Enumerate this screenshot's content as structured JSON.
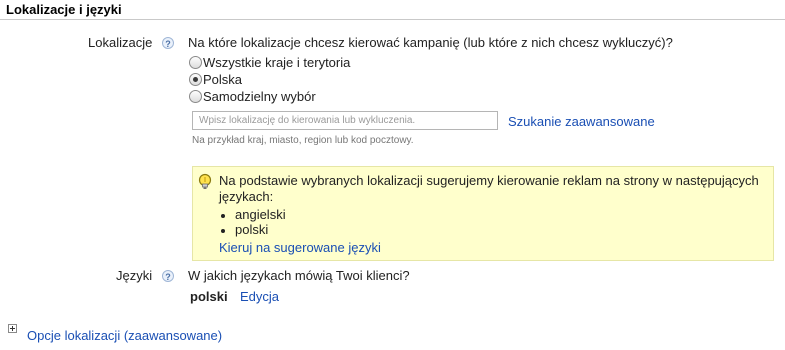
{
  "section": {
    "title": "Lokalizacje i języki"
  },
  "locations": {
    "label": "Lokalizacje",
    "help_glyph": "?",
    "question": "Na które lokalizacje chcesz kierować kampanię (lub które z nich chcesz wykluczyć)?",
    "options": [
      {
        "label": "Wszystkie kraje i terytoria",
        "checked": false
      },
      {
        "label": "Polska",
        "checked": true
      },
      {
        "label": "Samodzielny wybór",
        "checked": false
      }
    ],
    "input_placeholder": "Wpisz lokalizację do kierowania lub wykluczenia.",
    "advanced_search_link": "Szukanie zaawansowane",
    "hint": "Na przykład kraj, miasto, region lub kod pocztowy."
  },
  "suggestion": {
    "icon": "lightbulb-icon",
    "text": "Na podstawie wybranych lokalizacji sugerujemy kierowanie reklam na strony w następujących językach:",
    "languages": [
      "angielski",
      "polski"
    ],
    "apply_link": "Kieruj na sugerowane języki",
    "colors": {
      "background": "#ffffcc",
      "border": "#e6e6a6"
    }
  },
  "languages": {
    "label": "Języki",
    "help_glyph": "?",
    "question": "W jakich językach mówią Twoi klienci?",
    "current_value": "polski",
    "edit_link": "Edycja"
  },
  "advanced": {
    "expand_icon": "plus-box-icon",
    "link": "Opcje lokalizacji (zaawansowane)"
  },
  "colors": {
    "link": "#1a4fb4",
    "text": "#222222"
  }
}
